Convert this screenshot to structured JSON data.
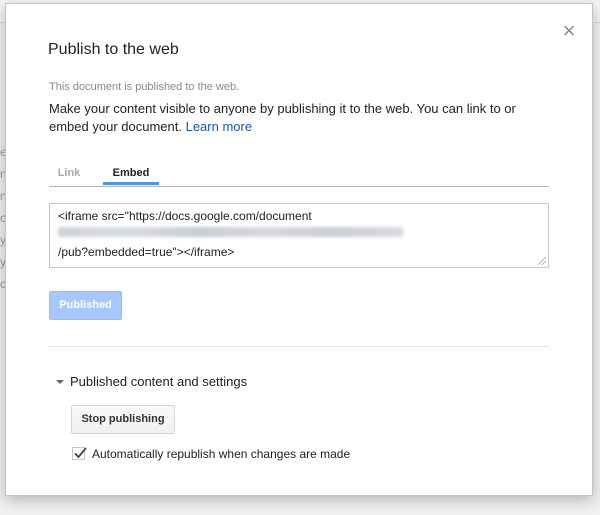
{
  "dialog": {
    "title": "Publish to the web",
    "status": "This document is published to the web.",
    "description": "Make your content visible to anyone by publishing it to the web. You can link to or embed your document.",
    "learn_more": "Learn more",
    "close_label": "×"
  },
  "tabs": [
    {
      "label": "Link",
      "active": false
    },
    {
      "label": "Embed",
      "active": true
    }
  ],
  "embed": {
    "line1": "<iframe src=\"https://docs.google.com/document",
    "line3": "/pub?embedded=true\"></iframe>"
  },
  "published_button": "Published",
  "settings": {
    "toggle_label": "Published content and settings",
    "stop_button": "Stop publishing",
    "auto_republish_label": "Automatically republish when changes are made",
    "auto_republish_checked": true
  },
  "background": {
    "side_letters": [
      "e",
      "n",
      "n",
      "o",
      "y",
      "y",
      "c"
    ]
  },
  "colors": {
    "accent": "#4d90fe",
    "link": "#1155cc",
    "published_button": "#a6c8ff"
  },
  "icons": {
    "close": "close-icon",
    "caret": "caret-down-icon",
    "check": "checkmark-icon",
    "resize": "resize-handle-icon"
  }
}
